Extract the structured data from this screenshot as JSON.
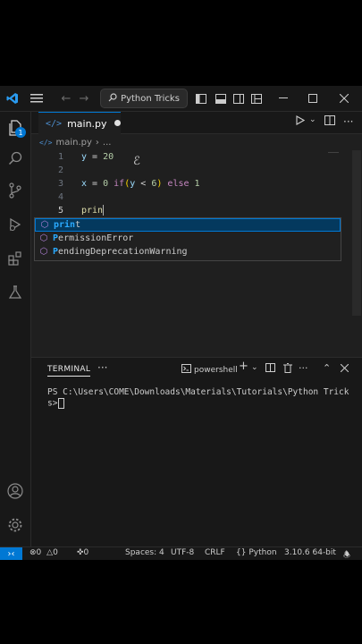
{
  "titlebar": {
    "search_label": "Python Tricks",
    "icons": [
      "vscode-logo",
      "menu-icon",
      "back-arrow-icon",
      "forward-arrow-icon",
      "search-icon",
      "layout-sidebar-icon",
      "layout-panel-icon",
      "layout-secondary-icon",
      "layout-customize-icon",
      "minimize-icon",
      "maximize-icon",
      "close-icon"
    ]
  },
  "activity_bar": {
    "explorer_badge": "1",
    "icons": [
      "files-icon",
      "search-icon",
      "source-control-icon",
      "run-debug-icon",
      "extensions-icon",
      "testing-icon",
      "account-icon",
      "settings-gear-icon"
    ]
  },
  "tab": {
    "label": "main.py",
    "dirty": true
  },
  "breadcrumb": {
    "file": "main.py",
    "symbol": "..."
  },
  "code": {
    "line_numbers": [
      "1",
      "2",
      "3",
      "4",
      "5"
    ],
    "line1": {
      "var": "y",
      "eq": " = ",
      "val": "20"
    },
    "line3": {
      "var": "x",
      "eq": " = ",
      "a": "0",
      "kw_if": "if",
      "p1": "(",
      "cond_var": "y",
      "lt": " < ",
      "b": "6",
      "p2": ")",
      "kw_else": "else",
      "c": "1"
    },
    "line5": {
      "typed": "prin"
    }
  },
  "suggestions": [
    {
      "match": "prin",
      "rest": "t",
      "full": "print",
      "selected": true
    },
    {
      "pre": "P",
      "m1": "e",
      "mid": "rmissionE",
      "m2": "rror",
      "full": "PermissionError"
    },
    {
      "pre": "P",
      "m1": "endingDeprecationWar",
      "rest": "ning",
      "full": "PendingDeprecationWarning"
    }
  ],
  "panel": {
    "tab_label": "TERMINAL",
    "more": "···",
    "shell_label": "powershell",
    "terminal_line1": "PS C:\\Users\\COME\\Downloads\\Materials\\Tutorials\\Python Tricks>"
  },
  "status_bar": {
    "errors": "0",
    "warnings": "0",
    "ports": "0",
    "spaces": "Spaces: 4",
    "encoding": "UTF-8",
    "eol": "CRLF",
    "language": "Python",
    "interpreter": "3.10.6 64-bit"
  },
  "colors": {
    "accent": "#0078d4",
    "editor_bg": "#1f1f1f",
    "chrome_bg": "#181818"
  }
}
